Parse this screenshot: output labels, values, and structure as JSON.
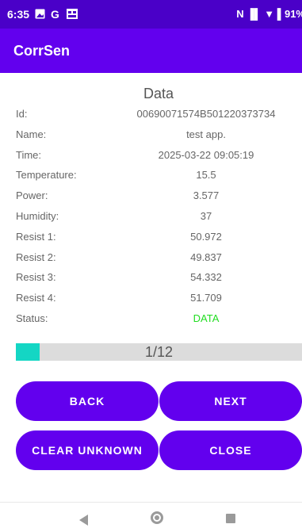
{
  "statusbar": {
    "time": "6:35",
    "left_icons": [
      "image-icon",
      "google-icon",
      "notification-icon"
    ],
    "right_text": "N ▐▌ ▼ ▌91%",
    "battery": "91%"
  },
  "appbar": {
    "title": "CorrSen"
  },
  "heading": "Data",
  "fields": [
    {
      "label": "Id:",
      "value": "00690071574B501220373734"
    },
    {
      "label": "Name:",
      "value": "test app."
    },
    {
      "label": "Time:",
      "value": "2025-03-22 09:05:19"
    },
    {
      "label": "Temperature:",
      "value": "15.5"
    },
    {
      "label": "Power:",
      "value": "3.577"
    },
    {
      "label": "Humidity:",
      "value": "37"
    },
    {
      "label": "Resist 1:",
      "value": "50.972"
    },
    {
      "label": "Resist 2:",
      "value": "49.837"
    },
    {
      "label": "Resist 3:",
      "value": "54.332"
    },
    {
      "label": "Resist 4:",
      "value": "51.709"
    },
    {
      "label": "Status:",
      "value": "DATA"
    }
  ],
  "progress": {
    "text": "1/12",
    "fraction": 0.0833
  },
  "buttons": {
    "back": "BACK",
    "next": "NEXT",
    "clear_unknown": "CLEAR UNKNOWN",
    "close": "CLOSE"
  },
  "colors": {
    "statusbar": "#4a00c8",
    "primary": "#6200ee",
    "status_ok": "#22dd22",
    "progress_fill": "#14d6c4",
    "progress_track": "#dcdcdc"
  }
}
